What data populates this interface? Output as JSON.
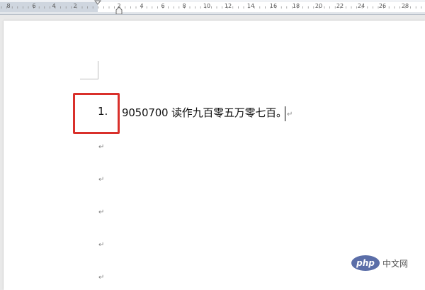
{
  "ruler": {
    "labels": [
      {
        "text": "8",
        "pos": 12
      },
      {
        "text": "6",
        "pos": 48
      },
      {
        "text": "4",
        "pos": 76
      },
      {
        "text": "2",
        "pos": 106
      },
      {
        "text": "2",
        "pos": 168
      },
      {
        "text": "4",
        "pos": 200
      },
      {
        "text": "6",
        "pos": 230
      },
      {
        "text": "8",
        "pos": 260
      },
      {
        "text": "10",
        "pos": 292
      },
      {
        "text": "12",
        "pos": 322
      },
      {
        "text": "14",
        "pos": 354
      },
      {
        "text": "16",
        "pos": 386
      },
      {
        "text": "18",
        "pos": 418
      },
      {
        "text": "20",
        "pos": 450
      },
      {
        "text": "22",
        "pos": 480
      },
      {
        "text": "24",
        "pos": 510
      },
      {
        "text": "26",
        "pos": 540
      },
      {
        "text": "28",
        "pos": 572
      }
    ]
  },
  "document": {
    "list_number": "1.",
    "list_text": "9050700 读作九百零五万零七百。",
    "trailing_mark": "↵",
    "paragraph_mark": "↵"
  },
  "watermark": {
    "logo_text": "php",
    "site_text": "中文网"
  },
  "colors": {
    "highlight": "#d9302b",
    "page": "#ffffff",
    "background": "#e9e9e9"
  }
}
